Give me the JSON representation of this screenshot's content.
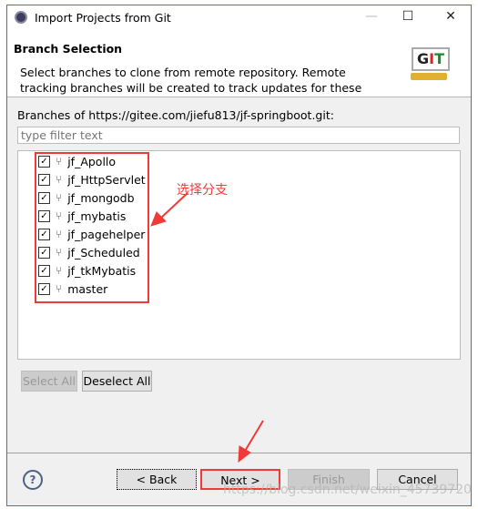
{
  "window": {
    "title": "Import Projects from Git"
  },
  "header": {
    "title": "Branch Selection",
    "description": "Select branches to clone from remote repository. Remote tracking branches will be created to track updates for these branches in the",
    "logo_text": "GIT"
  },
  "branches_label": "Branches of https://gitee.com/jiefu813/jf-springboot.git:",
  "filter": {
    "placeholder": "type filter text",
    "value": ""
  },
  "branches": [
    {
      "name": "jf_Apollo",
      "checked": true
    },
    {
      "name": "jf_HttpServlet",
      "checked": true
    },
    {
      "name": "jf_mongodb",
      "checked": true
    },
    {
      "name": "jf_mybatis",
      "checked": true
    },
    {
      "name": "jf_pagehelper",
      "checked": true
    },
    {
      "name": "jf_Scheduled",
      "checked": true
    },
    {
      "name": "jf_tkMybatis",
      "checked": true
    },
    {
      "name": "master",
      "checked": true
    }
  ],
  "buttons": {
    "select_all": "Select All",
    "deselect_all": "Deselect All",
    "back": "< Back",
    "next": "Next >",
    "finish": "Finish",
    "cancel": "Cancel"
  },
  "annotation": "选择分支",
  "watermark": "https://blog.csdn.net/weixin_45739720",
  "colors": {
    "annotation": "#f03a3a",
    "border": "#1883d7"
  }
}
